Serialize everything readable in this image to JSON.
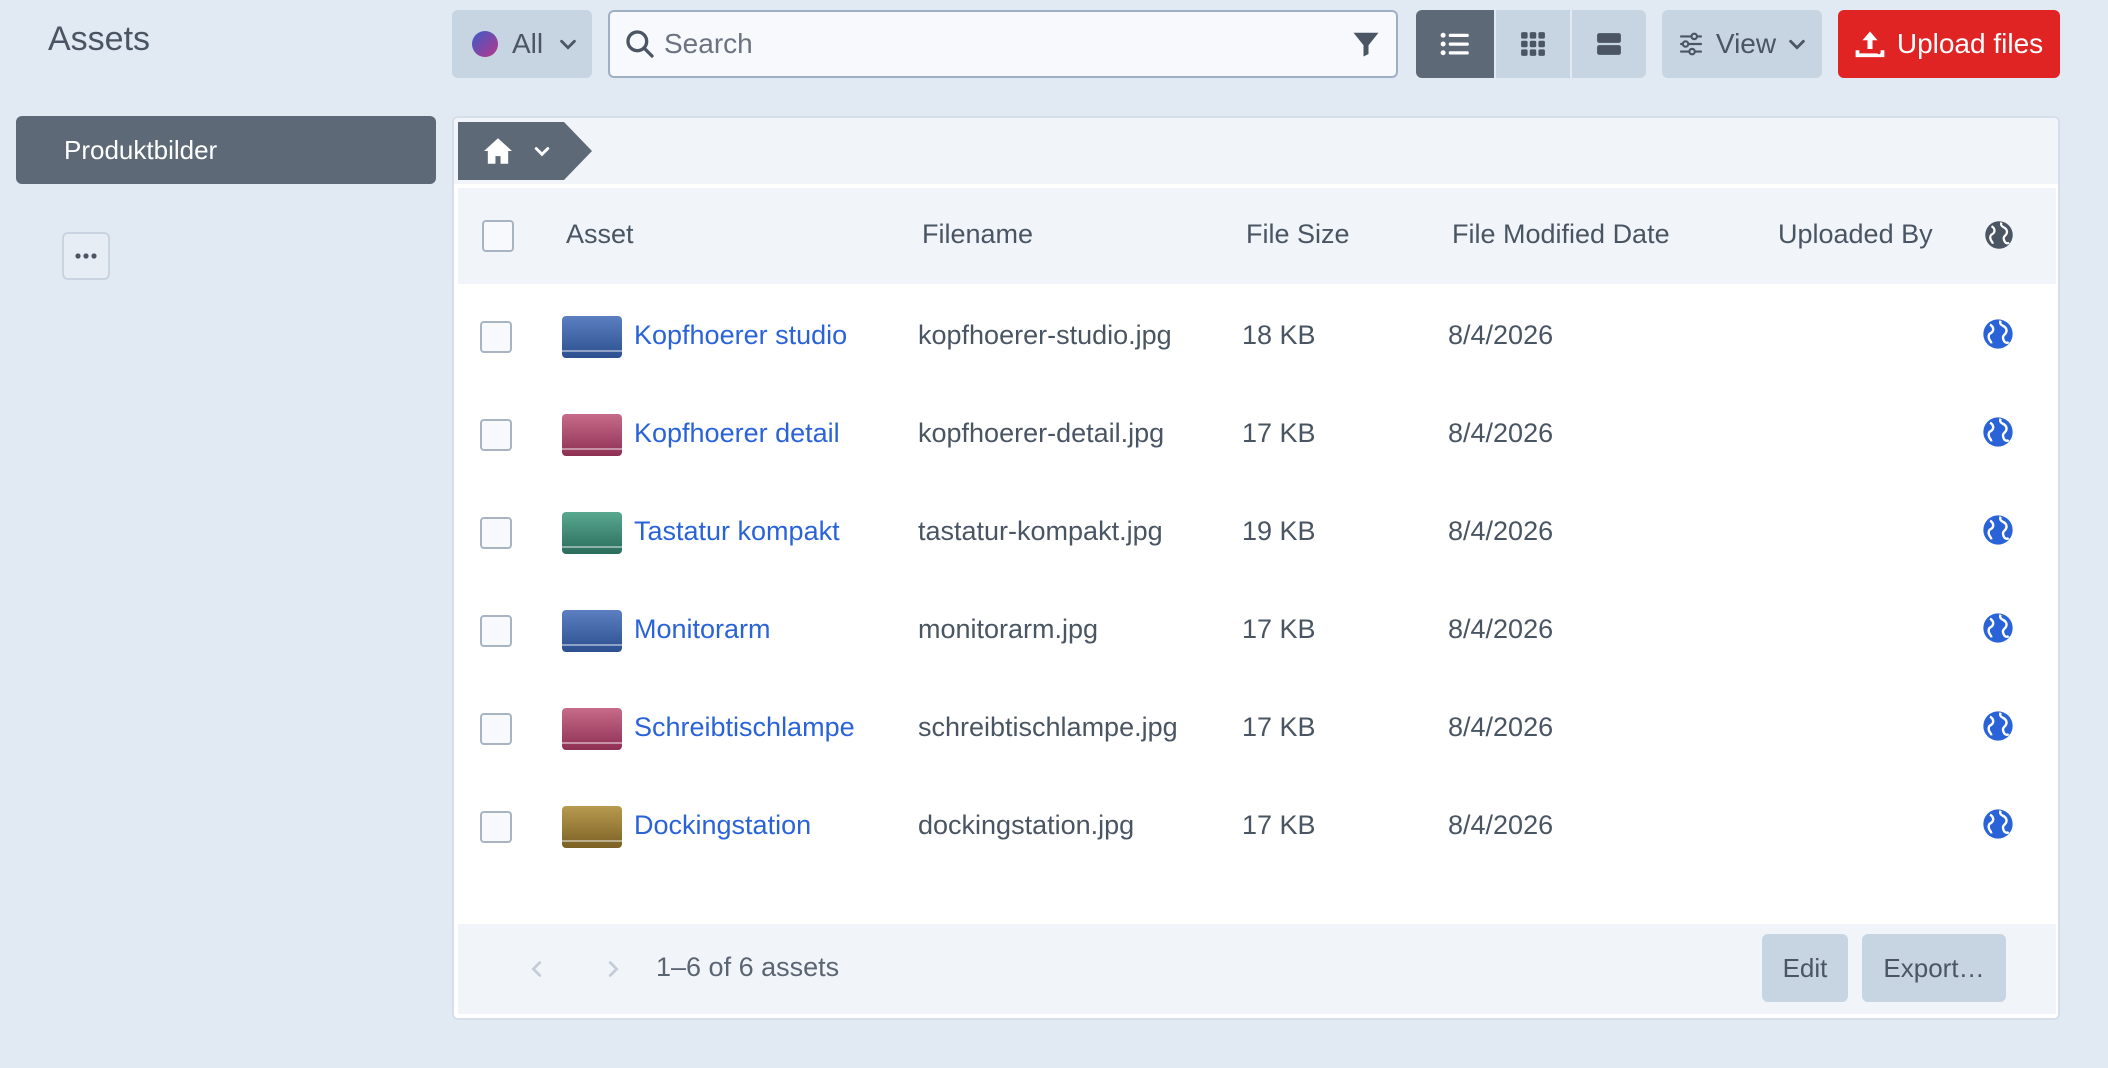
{
  "header": {
    "title": "Assets",
    "filter_label": "All",
    "search_placeholder": "Search",
    "view_label": "View",
    "upload_label": "Upload files"
  },
  "sidebar": {
    "items": [
      {
        "label": "Produktbilder"
      }
    ],
    "more_label": "•••"
  },
  "table": {
    "columns": [
      "Asset",
      "Filename",
      "File Size",
      "File Modified Date",
      "Uploaded By"
    ],
    "rows": [
      {
        "name": "Kopfhoerer studio",
        "filename": "kopfhoerer-studio.jpg",
        "size": "18 KB",
        "modified": "8/4/2026",
        "uploaded_by": "",
        "thumb": [
          "#5b7fc0",
          "#2c4f8f"
        ]
      },
      {
        "name": "Kopfhoerer detail",
        "filename": "kopfhoerer-detail.jpg",
        "size": "17 KB",
        "modified": "8/4/2026",
        "uploaded_by": "",
        "thumb": [
          "#c76b8a",
          "#8e3052"
        ]
      },
      {
        "name": "Tastatur kompakt",
        "filename": "tastatur-kompakt.jpg",
        "size": "19 KB",
        "modified": "8/4/2026",
        "uploaded_by": "",
        "thumb": [
          "#5aa890",
          "#2a6d5a"
        ]
      },
      {
        "name": "Monitorarm",
        "filename": "monitorarm.jpg",
        "size": "17 KB",
        "modified": "8/4/2026",
        "uploaded_by": "",
        "thumb": [
          "#5b7fc0",
          "#2c4f8f"
        ]
      },
      {
        "name": "Schreibtischlampe",
        "filename": "schreibtischlampe.jpg",
        "size": "17 KB",
        "modified": "8/4/2026",
        "uploaded_by": "",
        "thumb": [
          "#c76b8a",
          "#8e3052"
        ]
      },
      {
        "name": "Dockingstation",
        "filename": "dockingstation.jpg",
        "size": "17 KB",
        "modified": "8/4/2026",
        "uploaded_by": "",
        "thumb": [
          "#b89a50",
          "#7a6124"
        ]
      }
    ]
  },
  "footer": {
    "count": "1–6 of 6 assets",
    "edit_label": "Edit",
    "export_label": "Export…"
  },
  "colors": {
    "accent_link": "#2a63d8",
    "primary_dark": "#5d6976",
    "upload_red": "#e02424",
    "background": "#e1e9f3"
  }
}
